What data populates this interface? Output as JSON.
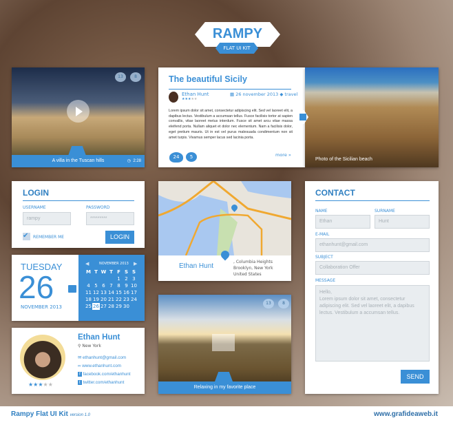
{
  "logo": {
    "title": "RAMPY",
    "subtitle": "FLAT UI KIT"
  },
  "video_card": {
    "caption": "A villa in the Tuscan hills",
    "duration": "2:28",
    "likes": "13",
    "comments": "8",
    "icon": "video-camera-icon"
  },
  "blog": {
    "title": "The beautiful Sicily",
    "author": "Ethan Hunt",
    "rating": 3,
    "date": "26 november 2013",
    "tag": "travel",
    "body": "Lorem ipsum dolor sit amet, consectetur adipiscing elit. Sed vel laoreet elit, a dapibus lectus. Vestibulum a accumsan tellus. Fusce facilisis tortor at sapien convallis, vitae laoreet metus interdum. Fusce sit amet arcu vitae massa eleifend porta. Nullam aliquet et dolor nec elementum. Nam a facilisis dolor, eget pretium mauris. Ut in est vel purus malesuada condimentum non sit amet turpis. Vivamus semper lacus sed lacinia porta.",
    "likes": "24",
    "comments": "5",
    "more": "more"
  },
  "beach": {
    "caption": "Photo of the Sicilian beach"
  },
  "login": {
    "title": "LOGIN",
    "username_label": "USERNAME",
    "username_value": "rampy",
    "password_label": "PASSWORD",
    "password_value": "*********",
    "remember": "REMEMBER ME",
    "remember_checked": true,
    "button": "LOGIN"
  },
  "map": {
    "name": "Ethan Hunt",
    "address1": ", Columbia Heights",
    "address2": "Brooklyn, New York",
    "address3": "United States"
  },
  "calendar": {
    "weekday": "TUESDAY",
    "day": "26",
    "month_year": "NOVEMBER 2013",
    "header": "NOVEMBER 2013",
    "weekdays": [
      "M",
      "T",
      "W",
      "T",
      "F",
      "S",
      "S"
    ],
    "weeks": [
      [
        "",
        "",
        "",
        "",
        "1",
        "2",
        "3"
      ],
      [
        "4",
        "5",
        "6",
        "7",
        "8",
        "9",
        "10"
      ],
      [
        "11",
        "12",
        "13",
        "14",
        "15",
        "16",
        "17"
      ],
      [
        "18",
        "19",
        "20",
        "21",
        "22",
        "23",
        "24"
      ],
      [
        "25",
        "26",
        "27",
        "28",
        "29",
        "30",
        ""
      ]
    ],
    "selected": "26"
  },
  "profile": {
    "name": "Ethan Hunt",
    "location": "New York",
    "rating": 3,
    "email": "ethanhunt@gmail.com",
    "website": "www.ethanhunt.com",
    "facebook": "facebook.com/ethanhunt",
    "twitter": "twitter.com/ethanhunt"
  },
  "photo_card": {
    "caption": "Relaxing in my favorite place",
    "likes": "13",
    "comments": "8"
  },
  "contact": {
    "title": "CONTACT",
    "name_label": "NAME",
    "name_value": "Ethan",
    "surname_label": "SURNAME",
    "surname_value": "Hunt",
    "email_label": "E-MAIL",
    "email_value": "ethanhunt@gmail.com",
    "subject_label": "SUBJECT",
    "subject_value": "Collaboration Offer",
    "message_label": "MESSAGE",
    "message_value": "Hello,\nLorem ipsum dolor sit amet, consectetur adipiscing elit. Sed vel laoreet elit, a dapibus lectus. Vestibulum a accumsan tellus.",
    "button": "SEND"
  },
  "footer": {
    "title": "Rampy Flat UI Kit",
    "version": "version 1.0",
    "website": "www.grafideaweb.it"
  },
  "colors": {
    "accent": "#3a8fd6",
    "input_bg": "#e9edf0"
  }
}
